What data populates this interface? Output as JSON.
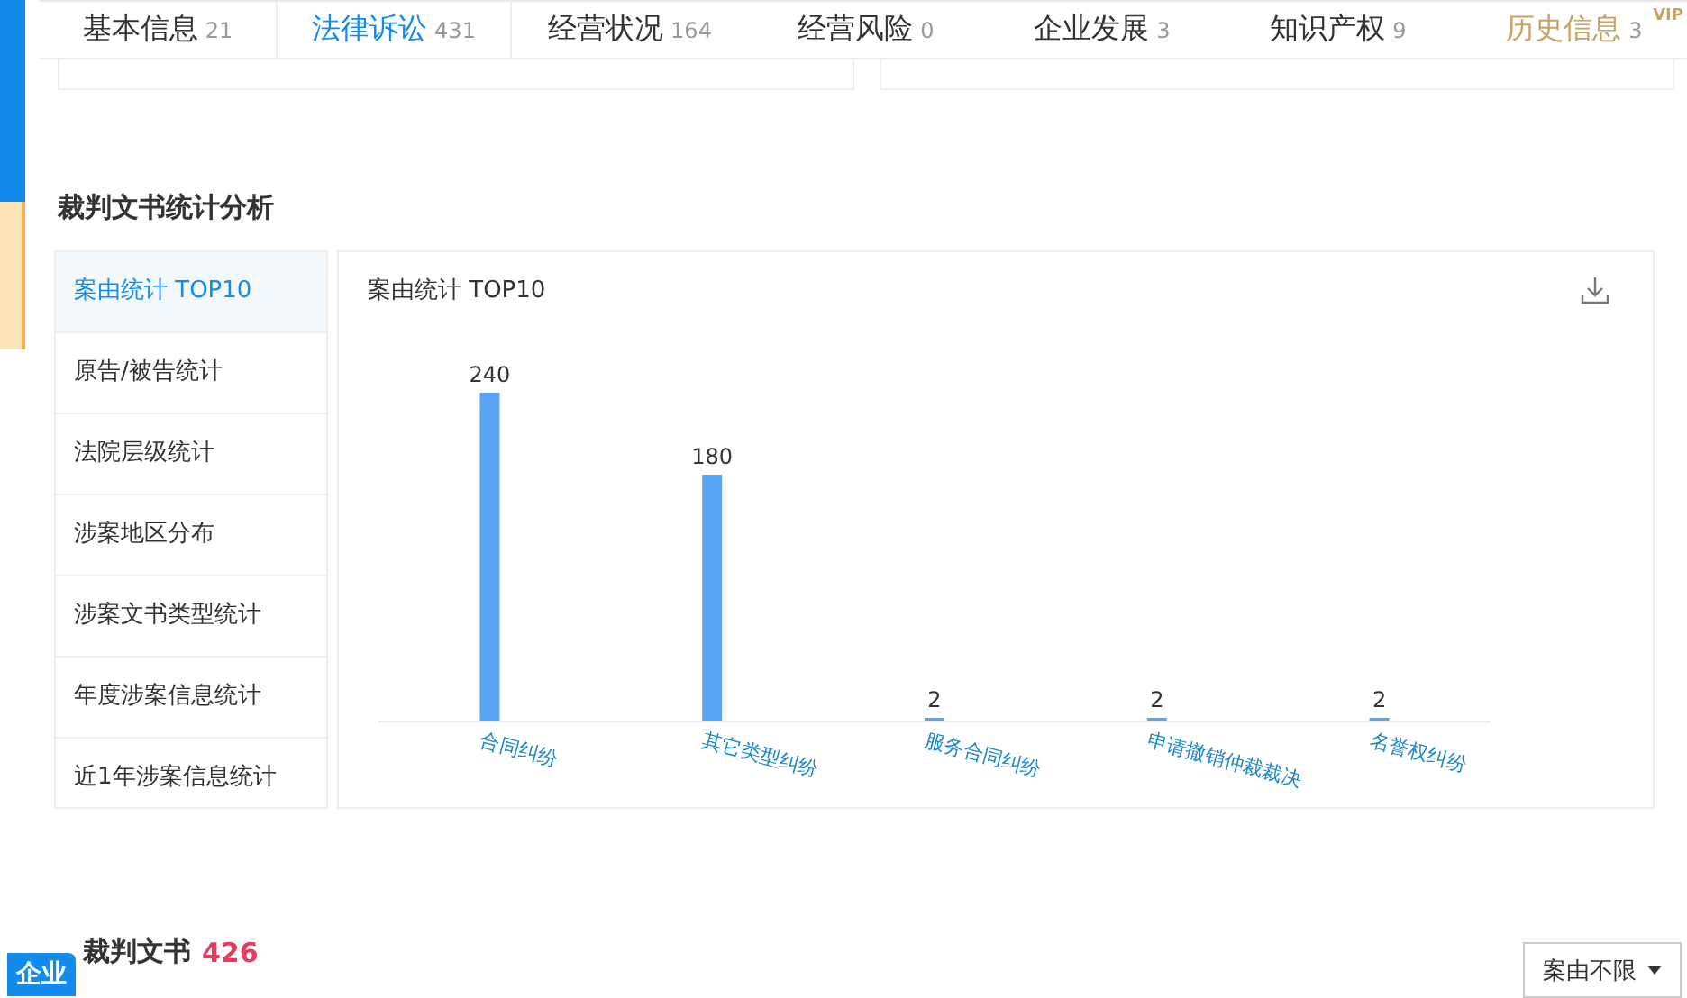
{
  "tabs": [
    {
      "label": "基本信息",
      "count": "21",
      "selected": false
    },
    {
      "label": "法律诉讼",
      "count": "431",
      "selected": true
    },
    {
      "label": "经营状况",
      "count": "164",
      "selected": false
    },
    {
      "label": "经营风险",
      "count": "0",
      "selected": false
    },
    {
      "label": "企业发展",
      "count": "3",
      "selected": false
    },
    {
      "label": "知识产权",
      "count": "9",
      "selected": false
    },
    {
      "label": "历史信息",
      "count": "3",
      "selected": false,
      "badge": "VIP"
    }
  ],
  "analysis": {
    "title": "裁判文书统计分析",
    "menu": [
      {
        "label": "案由统计 TOP10",
        "selected": true
      },
      {
        "label": "原告/被告统计",
        "selected": false
      },
      {
        "label": "法院层级统计",
        "selected": false
      },
      {
        "label": "涉案地区分布",
        "selected": false
      },
      {
        "label": "涉案文书类型统计",
        "selected": false
      },
      {
        "label": "年度涉案信息统计",
        "selected": false
      },
      {
        "label": "近1年涉案信息统计",
        "selected": false
      }
    ],
    "panel_title": "案由统计 TOP10",
    "chart_data": {
      "type": "bar",
      "categories": [
        "合同纠纷",
        "其它类型纠纷",
        "服务合同纠纷",
        "申请撤销仲裁裁决",
        "名誉权纠纷"
      ],
      "series": [
        {
          "color": "#5aa4f4",
          "values": [
            240,
            180,
            2,
            2,
            2
          ]
        }
      ],
      "data_labels": true
    }
  },
  "documents": {
    "badge": "企业",
    "title": "裁判文书",
    "count": "426",
    "filter": "案由不限"
  }
}
